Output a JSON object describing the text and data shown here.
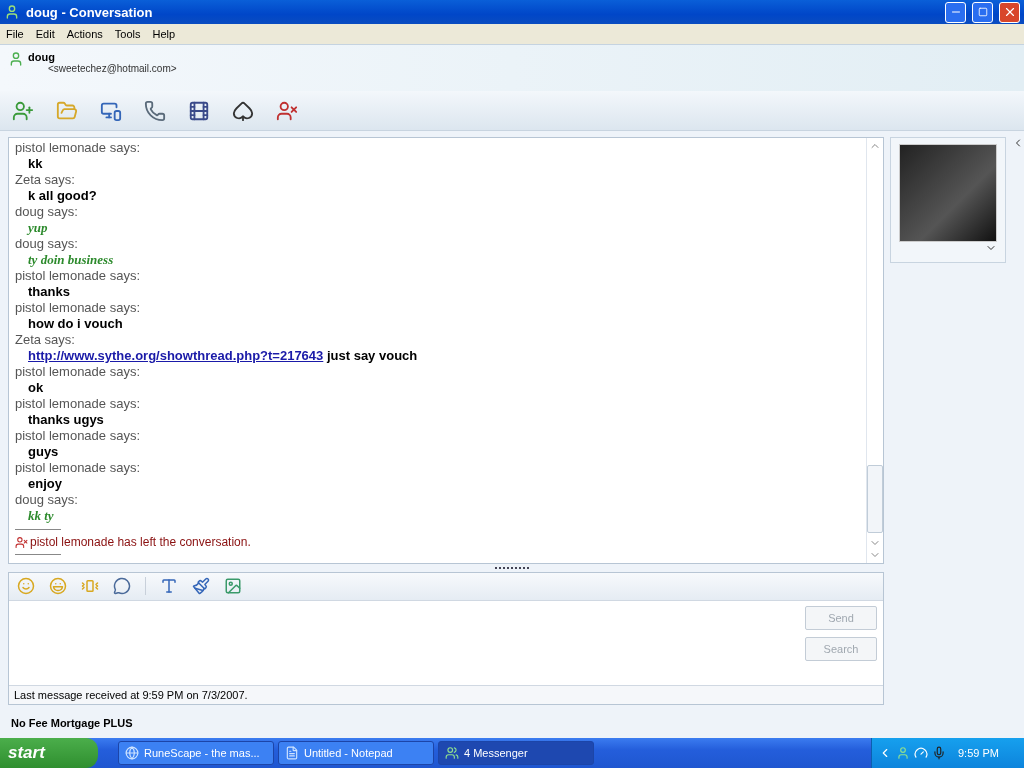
{
  "window": {
    "title": "doug - Conversation"
  },
  "menu": [
    "File",
    "Edit",
    "Actions",
    "Tools",
    "Help"
  ],
  "contact": {
    "name": "doug",
    "email": "<sweetechez@hotmail.com>"
  },
  "messages": [
    {
      "header": "pistol lemonade says:",
      "text": "kk",
      "own": false
    },
    {
      "header": "Zeta says:",
      "text": "k all good?",
      "own": false
    },
    {
      "header": "doug says:",
      "text": "yup",
      "own": true
    },
    {
      "header": "doug says:",
      "text": "ty doin business",
      "own": true
    },
    {
      "header": "pistol lemonade says:",
      "text": "thanks",
      "own": false
    },
    {
      "header": "pistol lemonade says:",
      "text": "how do i vouch",
      "own": false
    },
    {
      "header": "Zeta says:",
      "link": "http://www.sythe.org/showthread.php?t=217643",
      "text": "just say vouch",
      "own": false
    },
    {
      "header": "pistol lemonade says:",
      "text": "ok",
      "own": false
    },
    {
      "header": "pistol lemonade says:",
      "text": "thanks ugys",
      "own": false
    },
    {
      "header": "pistol lemonade says:",
      "text": "guys",
      "own": false
    },
    {
      "header": "pistol lemonade says:",
      "text": "enjoy",
      "own": false
    },
    {
      "header": "doug says:",
      "text": "kk ty",
      "own": true
    }
  ],
  "event": "pistol lemonade has left the conversation.",
  "buttons": [
    {
      "label": "Send",
      "disabled": true
    },
    {
      "label": "Search",
      "disabled": true
    }
  ],
  "status": "Last message received at 9:59 PM on 7/3/2007.",
  "ad": "No Fee Mortgage PLUS",
  "taskbar": {
    "start": "start",
    "tasks": [
      {
        "label": "RuneScape - the mas...",
        "kind": "browser",
        "selected": false
      },
      {
        "label": "Untitled - Notepad",
        "kind": "notepad",
        "selected": false
      },
      {
        "label": "4 Messenger",
        "kind": "messenger",
        "selected": true
      }
    ],
    "clock": "9:59 PM"
  }
}
